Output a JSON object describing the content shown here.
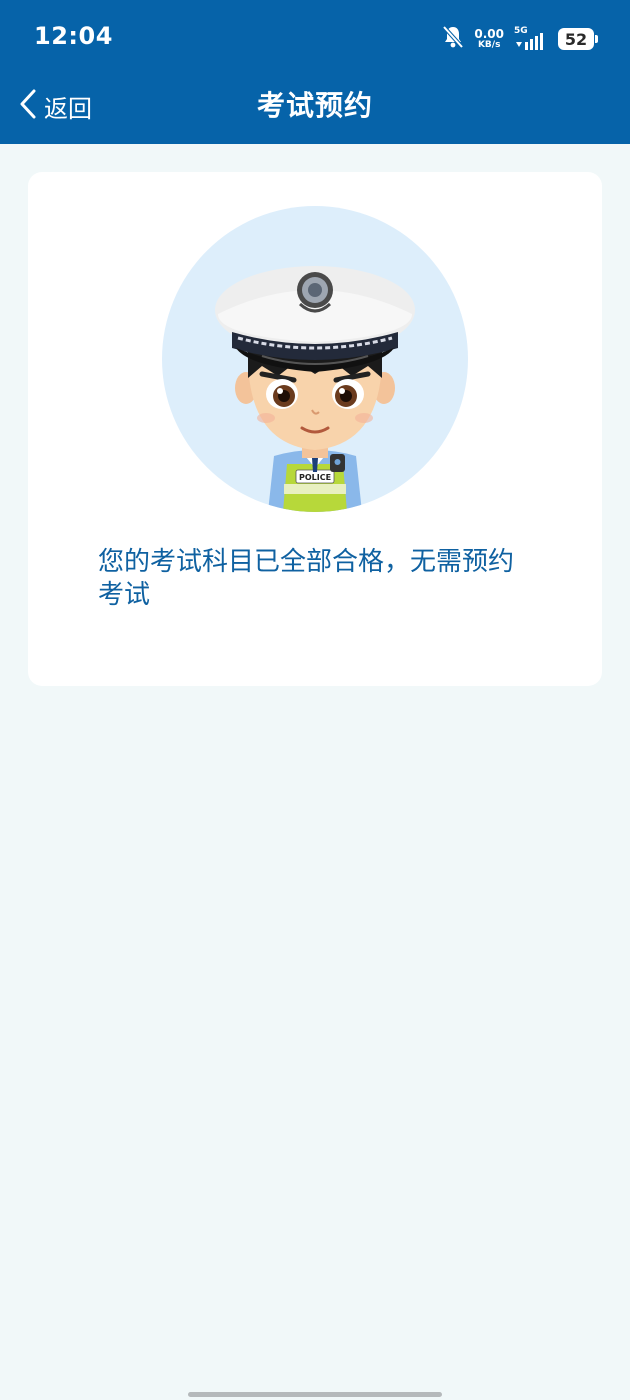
{
  "status_bar": {
    "time": "12:04",
    "net_speed_value": "0.00",
    "net_speed_unit": "KB/s",
    "network_type": "5G",
    "battery_level": "52",
    "icons": [
      "mute-bell-icon",
      "signal-icon",
      "battery-icon"
    ]
  },
  "header": {
    "back_label": "返回",
    "title": "考试预约",
    "background_color": "#0663a9"
  },
  "card": {
    "illustration": "police-officer-avatar",
    "badge_text": "POLICE",
    "message": "您的考试科目已全部合格，无需预约考试",
    "message_color": "#0f61a1"
  }
}
